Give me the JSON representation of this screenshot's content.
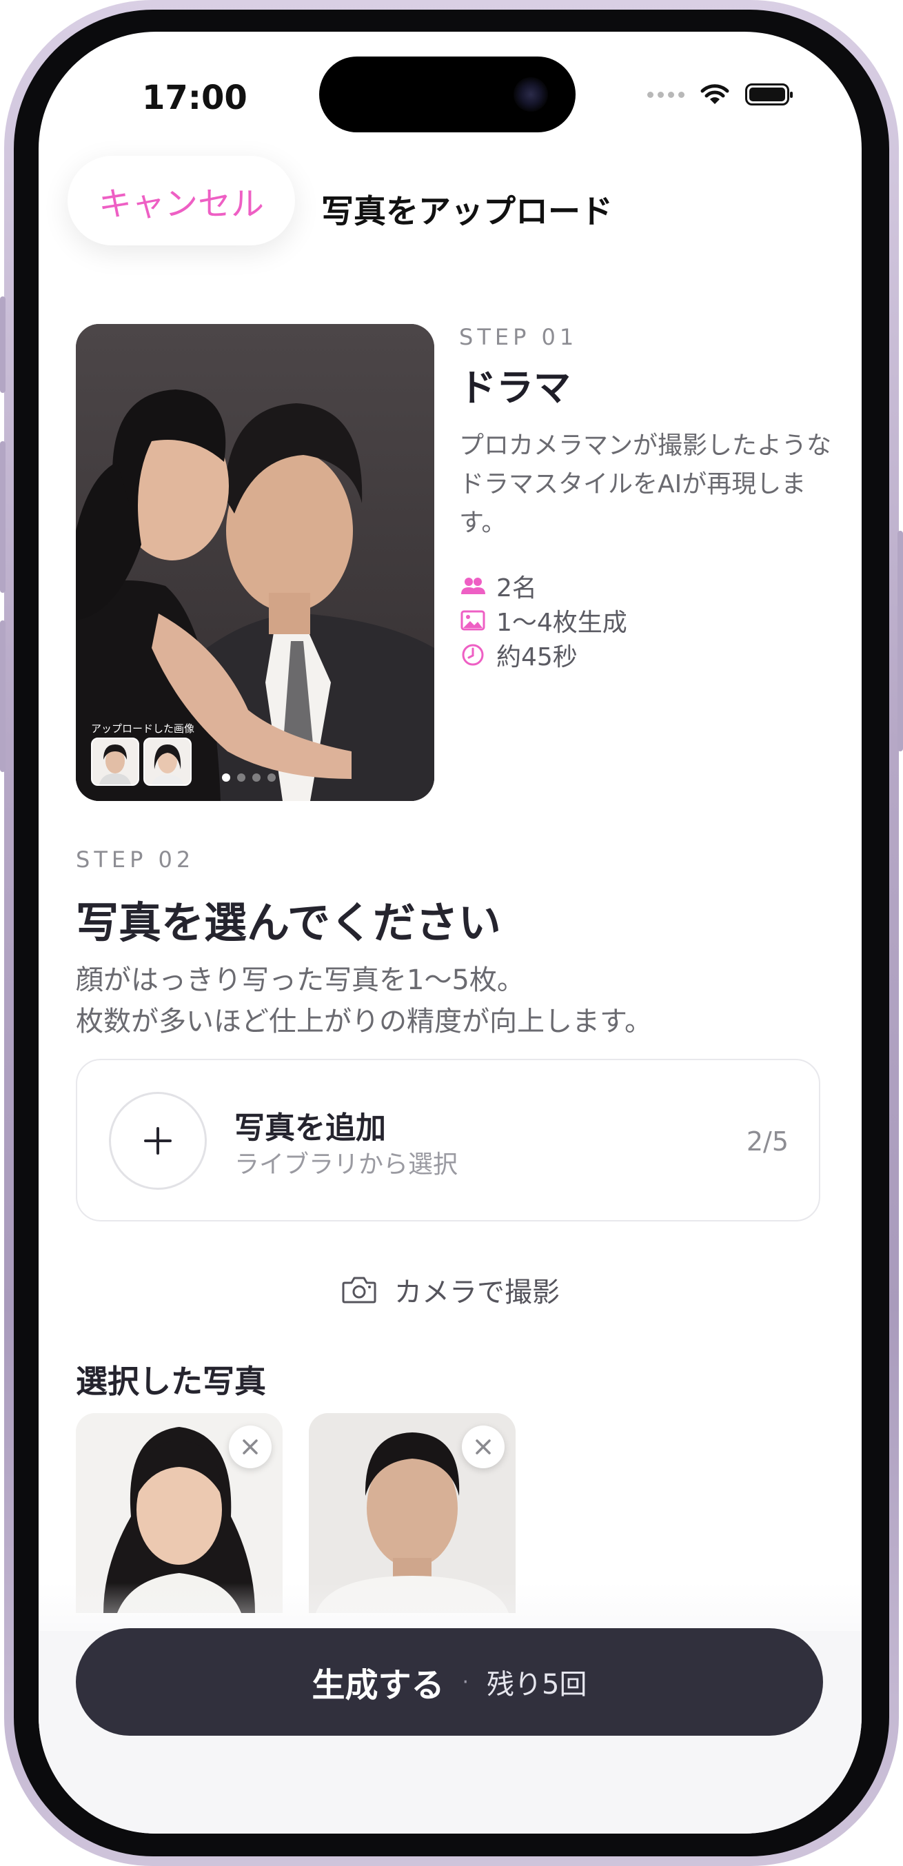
{
  "status_bar": {
    "time": "17:00"
  },
  "nav": {
    "cancel_label": "キャンセル",
    "title": "写真をアップロード"
  },
  "step1": {
    "label": "STEP 01",
    "title": "ドラマ",
    "description": "プロカメラマンが撮影したようなドラマスタイルをAIが再現します。",
    "meta": {
      "people": "2名",
      "images": "1〜4枚生成",
      "time": "約45秒"
    },
    "preview": {
      "uploaded_caption": "アップロードした画像",
      "page_count": 4,
      "current_page": 1
    }
  },
  "step2": {
    "label": "STEP 02",
    "title": "写真を選んでください",
    "desc_line1": "顔がはっきり写った写真を1〜5枚。",
    "desc_line2": "枚数が多いほど仕上がりの精度が向上します。"
  },
  "add_photo": {
    "title": "写真を追加",
    "subtitle": "ライブラリから選択",
    "count": "2/5"
  },
  "camera": {
    "label": "カメラで撮影"
  },
  "selected": {
    "title": "選択した写真"
  },
  "cta": {
    "main": "生成する",
    "separator": "·",
    "sub": "残り5回"
  },
  "colors": {
    "accent": "#ee5fc4",
    "cta_bg": "#31303d",
    "text_dark": "#25242e"
  }
}
